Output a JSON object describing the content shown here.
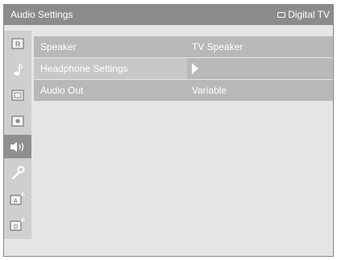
{
  "header": {
    "title": "Audio Settings",
    "source_icon": "tv-icon",
    "source_label": "Digital TV"
  },
  "sidebar": {
    "items": [
      {
        "name": "picture-icon",
        "active": false
      },
      {
        "name": "music-note-icon",
        "active": false
      },
      {
        "name": "screen-icon",
        "active": false
      },
      {
        "name": "setup-icon",
        "active": false
      },
      {
        "name": "speaker-icon",
        "active": true
      },
      {
        "name": "wrench-icon",
        "active": false
      },
      {
        "name": "antenna-tv-a-icon",
        "active": false
      },
      {
        "name": "antenna-tv-d-icon",
        "active": false
      }
    ]
  },
  "menu": {
    "rows": [
      {
        "label": "Speaker",
        "value": "TV Speaker",
        "selected": false
      },
      {
        "label": "Headphone Settings",
        "value": "",
        "selected": true,
        "submenu_icon": "arrow-right-icon"
      },
      {
        "label": "Audio Out",
        "value": "Variable",
        "selected": false
      }
    ]
  },
  "colors": {
    "header_bg": "#8b8b8b",
    "panel_bg": "#e5e5e5",
    "sidebar_bg": "#cfcfcf",
    "row_bg": "#b8b8b8",
    "selected_row_bg": "#c8c8c8",
    "text": "#ffffff"
  }
}
